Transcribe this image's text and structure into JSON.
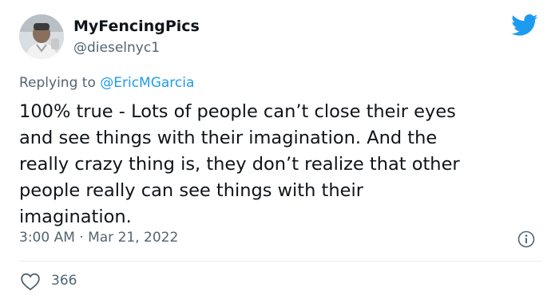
{
  "author": {
    "display_name": "MyFencingPics",
    "handle": "@dieselnyc1",
    "avatar_icon": "user-avatar-photo"
  },
  "reply": {
    "prefix": "Replying to",
    "mention": "@EricMGarcia"
  },
  "tweet": {
    "lines": [
      "100% true - Lots of people can’t close their eyes",
      "and see things with their imagination. And the",
      "really crazy thing is, they don’t realize that other",
      "people really can see things with their",
      "imagination."
    ],
    "timestamp": "3:00 AM · Mar 21, 2022"
  },
  "stats": {
    "likes": "366"
  },
  "icons": {
    "brand": "twitter-bird-icon",
    "info": "info-icon",
    "like": "heart-icon"
  },
  "colors": {
    "brand_blue": "#1d9bf0",
    "text_primary": "#0f1419",
    "text_secondary": "#536471",
    "divider": "#e6ecf0"
  }
}
